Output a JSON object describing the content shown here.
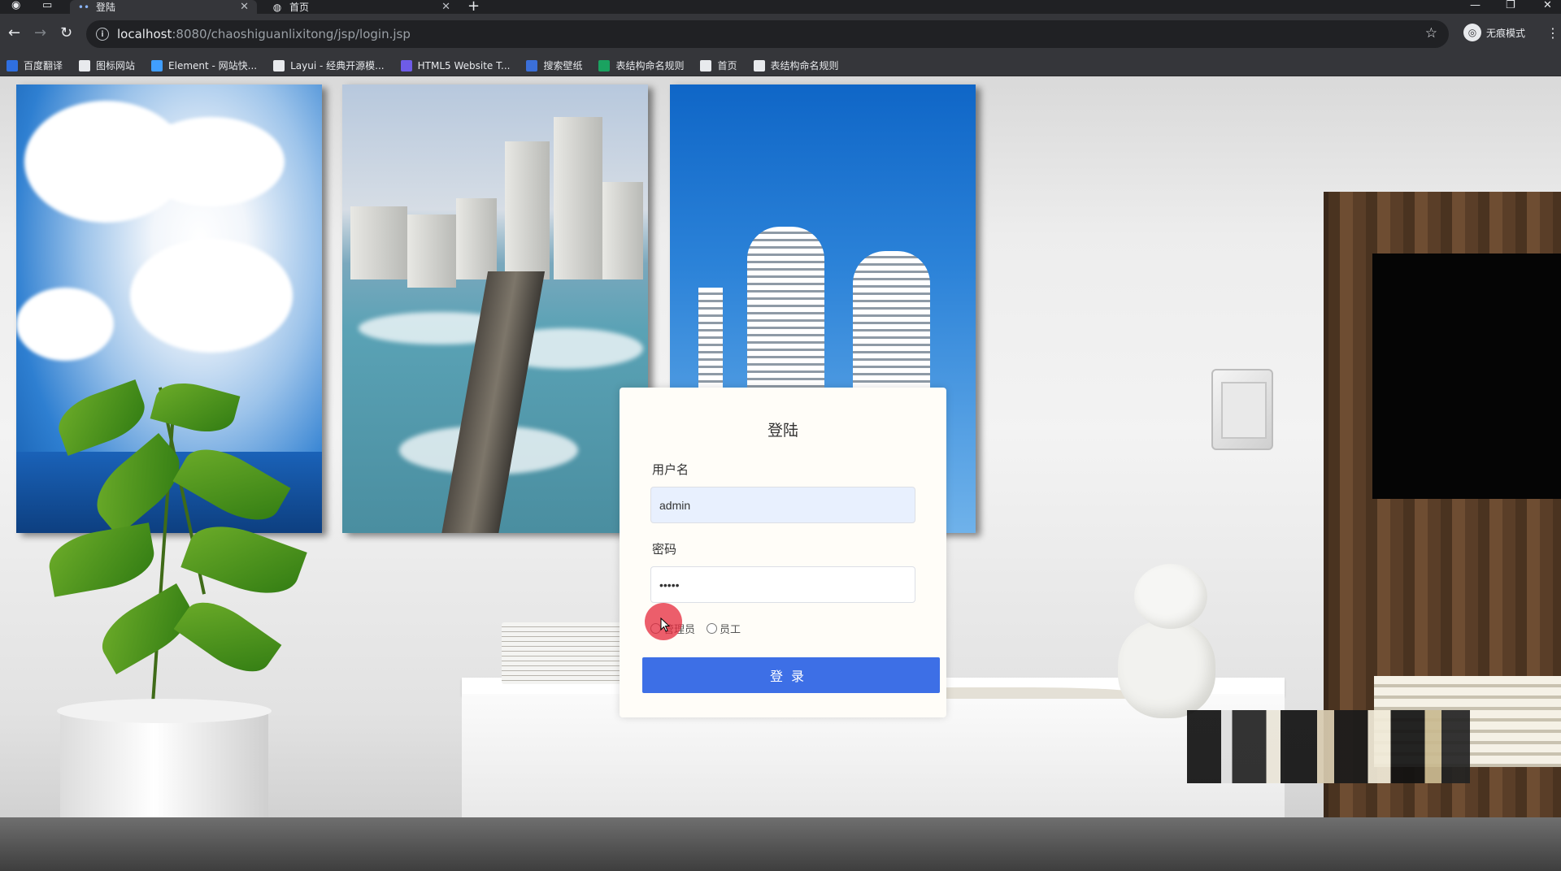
{
  "browser": {
    "tabs": [
      {
        "title": "登陆",
        "active": true
      },
      {
        "title": "首页",
        "active": false
      }
    ],
    "url_host": "localhost",
    "url_rest": ":8080/chaoshiguanlixitong/jsp/login.jsp",
    "profile_label": "无痕模式",
    "bookmarks": [
      {
        "label": "百度翻译",
        "icon": "translate-icon",
        "color": "#2f6fe0"
      },
      {
        "label": "图标网站",
        "icon": "flag-icon",
        "color": "#e8eaed"
      },
      {
        "label": "Element - 网站快...",
        "icon": "element-icon",
        "color": "#409eff"
      },
      {
        "label": "Layui - 经典开源模...",
        "icon": "layui-icon",
        "color": "#e8eaed"
      },
      {
        "label": "HTML5 Website T...",
        "icon": "html5-icon",
        "color": "#6e5ce8"
      },
      {
        "label": "搜索壁纸",
        "icon": "wallpaper-icon",
        "color": "#3b6fd8"
      },
      {
        "label": "表结构命名规则",
        "icon": "sheet-icon",
        "color": "#1aa260"
      },
      {
        "label": "首页",
        "icon": "globe-icon",
        "color": "#e8eaed"
      },
      {
        "label": "表结构命名规则",
        "icon": "globe-icon",
        "color": "#e8eaed"
      }
    ]
  },
  "login": {
    "title": "登陆",
    "username_label": "用户名",
    "username_value": "admin",
    "password_label": "密码",
    "password_value": "•••••",
    "roles": [
      "管理员",
      "员工"
    ],
    "submit_label": "登录"
  },
  "colors": {
    "primary_button": "#3d6fe6",
    "autofill_bg": "#e8f0fe",
    "card_bg": "#fffdf8"
  }
}
